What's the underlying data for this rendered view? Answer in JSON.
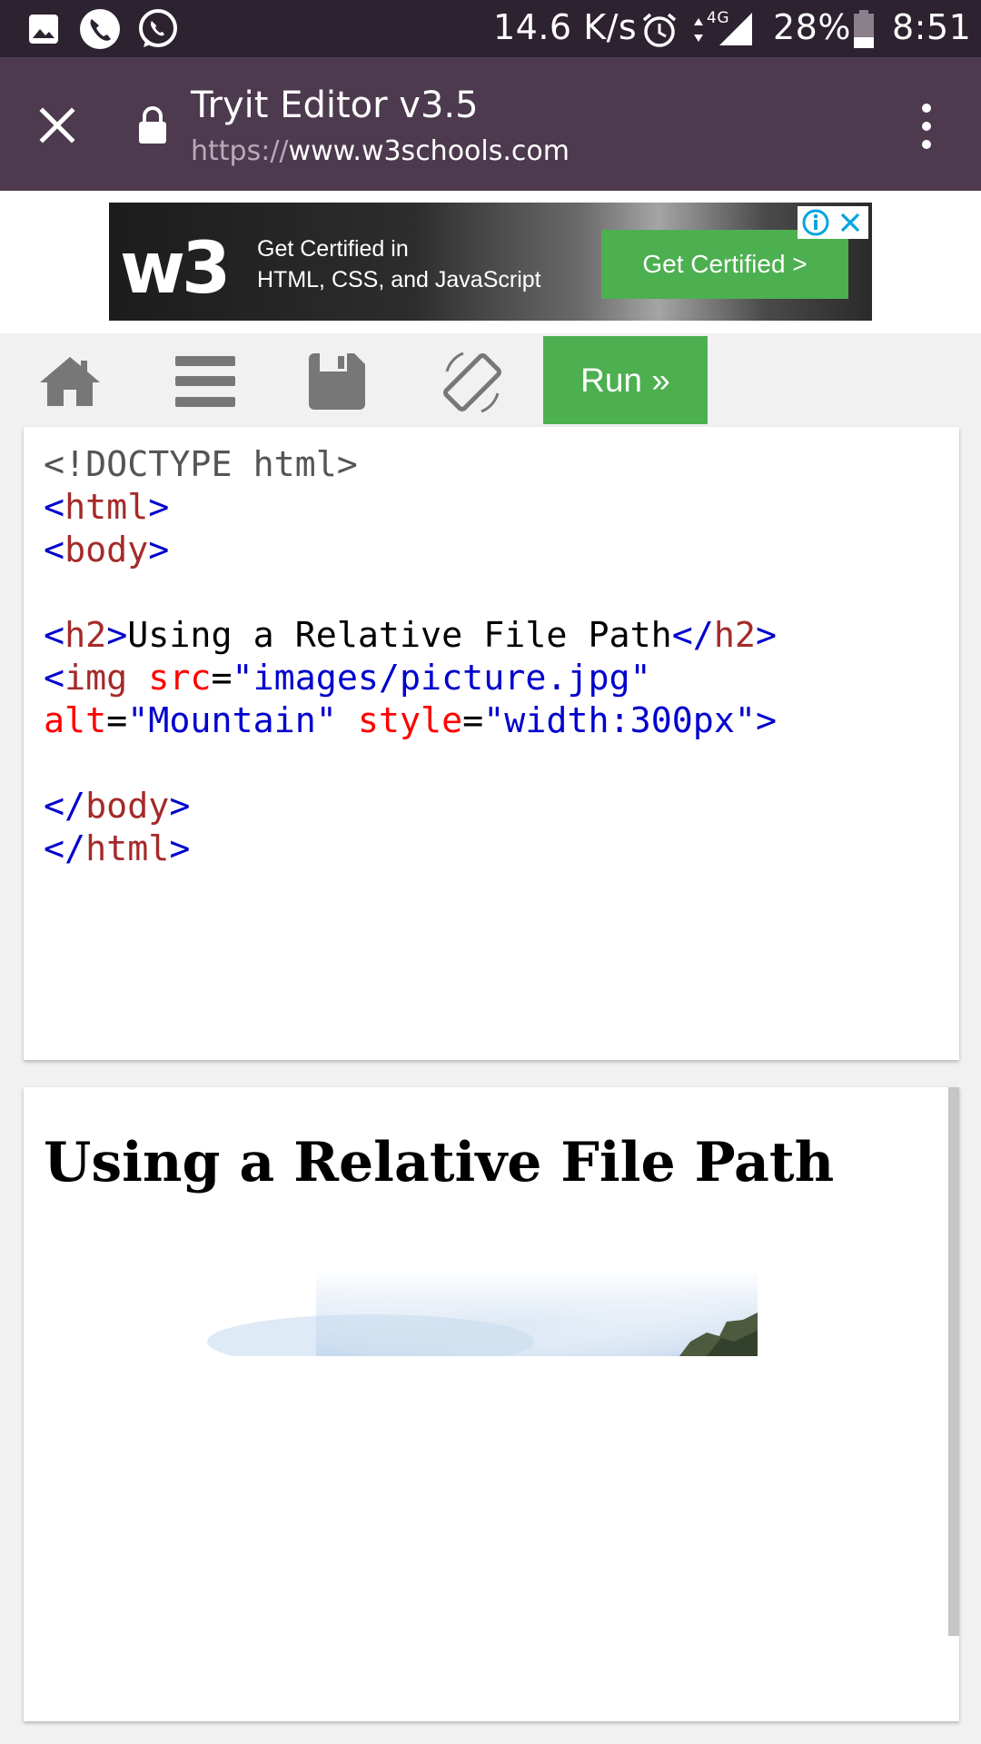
{
  "status_bar": {
    "net_speed": "14.6 K/s",
    "network": "4G",
    "battery": "28%",
    "time": "8:51",
    "icons": [
      "gallery-icon",
      "phone-call-icon",
      "whatsapp-icon",
      "alarm-icon",
      "data-arrows-icon",
      "signal-icon",
      "battery-icon"
    ]
  },
  "browser": {
    "title": "Tryit Editor v3.5",
    "url_scheme": "https://",
    "url_host": "www.w3schools.com"
  },
  "ad": {
    "logo_text": "w3",
    "line1": "Get Certified in",
    "line2": "HTML, CSS, and JavaScript",
    "cta": "Get Certified >",
    "info_icon": "info-icon",
    "close_icon": "close-icon"
  },
  "toolbar": {
    "run_label": "Run »",
    "icons": [
      "home-icon",
      "menu-icon",
      "save-icon",
      "rotate-icon"
    ]
  },
  "code": {
    "l1": "<!DOCTYPE html>",
    "lt": "<",
    "gt": ">",
    "lts": "</",
    "eq": "=",
    "html": "html",
    "body": "body",
    "h2": "h2",
    "img": "img",
    "h2_text": "Using a Relative File Path",
    "attr_src": "src",
    "val_src": "\"images/picture.jpg\"",
    "attr_alt": "alt",
    "val_alt": "\"Mountain\"",
    "attr_style": "style",
    "val_style": "\"width:300px\""
  },
  "result": {
    "heading": "Using a Relative File Path"
  },
  "colors": {
    "status_bar_bg": "#2c2230",
    "browser_bar_bg": "#4d3a4e",
    "run_green": "#4caf50",
    "code_tag": "#a52a2a",
    "code_attr": "#ff0000",
    "code_value": "#0000cd"
  }
}
